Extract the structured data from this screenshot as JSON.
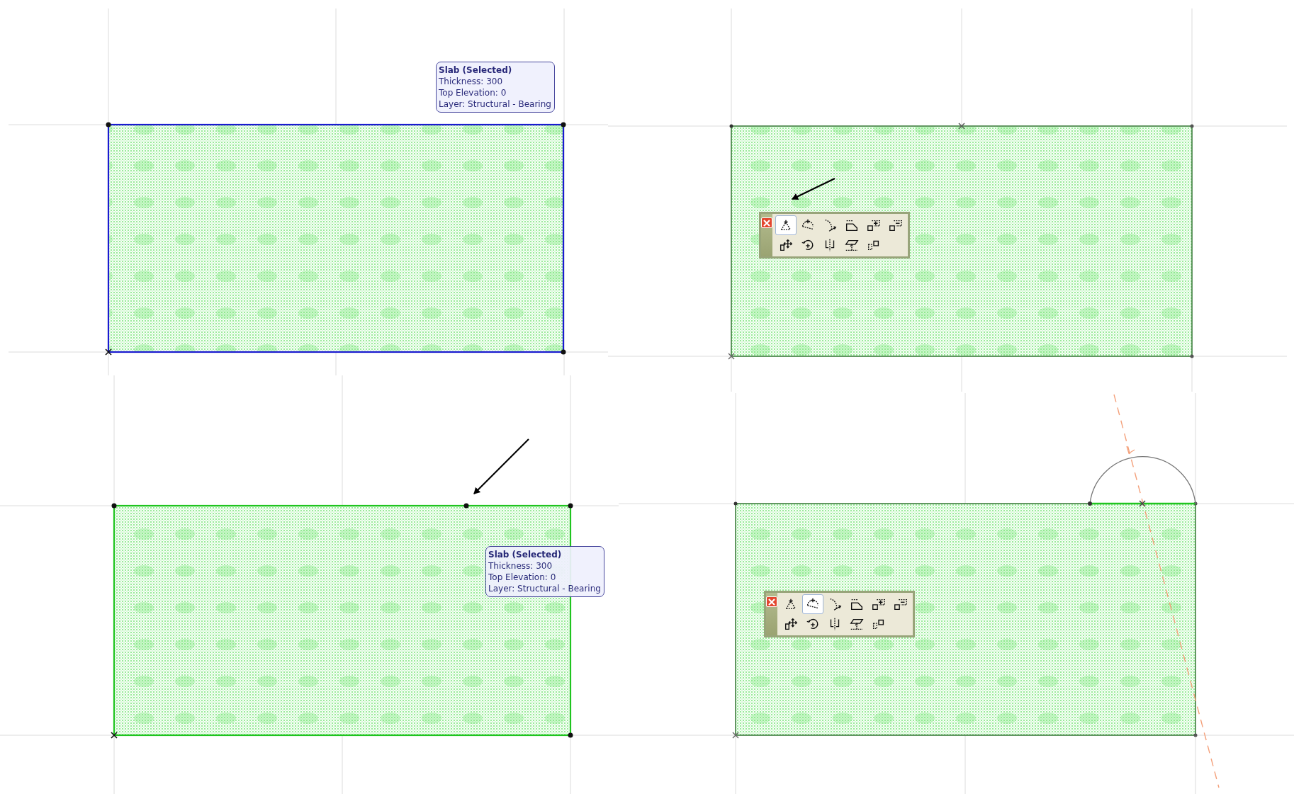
{
  "panels": [
    {
      "kind": "selected",
      "tooltip": {
        "title": "Slab (Selected)",
        "lines": [
          "Thickness: 300",
          "Top Elevation: 0",
          "Layer: Structural - Bearing"
        ]
      }
    },
    {
      "kind": "palette",
      "toolbar": {
        "tools": [
          {
            "kind": "add-node",
            "selected": true
          },
          {
            "kind": "arc-node",
            "selected": false
          },
          {
            "kind": "curve-edge",
            "selected": false
          },
          {
            "kind": "chamfer",
            "selected": false
          },
          {
            "kind": "add-shape",
            "selected": false
          },
          {
            "kind": "subtract-shape",
            "selected": false
          },
          {
            "kind": "move",
            "selected": false
          },
          {
            "kind": "rotate",
            "selected": false
          },
          {
            "kind": "mirror",
            "selected": false
          },
          {
            "kind": "elevate",
            "selected": false
          },
          {
            "kind": "resize",
            "selected": false
          }
        ]
      }
    },
    {
      "kind": "edge-hover",
      "tooltip": {
        "title": "Slab (Selected)",
        "lines": [
          "Thickness: 300",
          "Top Elevation: 0",
          "Layer: Structural - Bearing"
        ]
      }
    },
    {
      "kind": "arc-edit",
      "toolbar": {
        "tools": [
          {
            "kind": "add-node",
            "selected": false
          },
          {
            "kind": "arc-node",
            "selected": true
          },
          {
            "kind": "curve-edge",
            "selected": false
          },
          {
            "kind": "chamfer",
            "selected": false
          },
          {
            "kind": "add-shape",
            "selected": false
          },
          {
            "kind": "subtract-shape",
            "selected": false
          },
          {
            "kind": "move",
            "selected": false
          },
          {
            "kind": "rotate",
            "selected": false
          },
          {
            "kind": "mirror",
            "selected": false
          },
          {
            "kind": "elevate",
            "selected": false
          },
          {
            "kind": "resize",
            "selected": false
          }
        ]
      }
    }
  ]
}
